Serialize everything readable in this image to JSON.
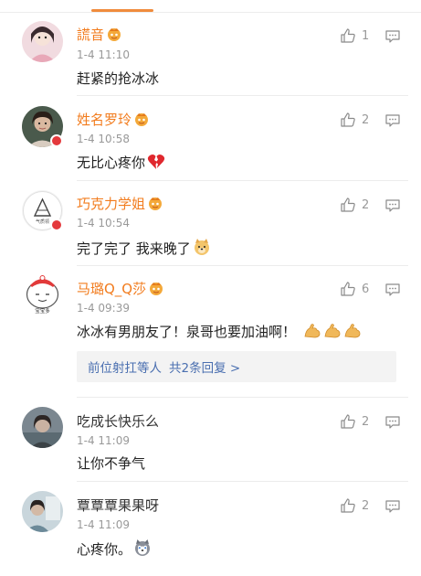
{
  "comments": [
    {
      "username": "謊音",
      "vip": true,
      "time": "1-4 11:10",
      "text": "赶紧的抢冰冰",
      "likes": "1"
    },
    {
      "username": "姓名罗玲",
      "vip": true,
      "time": "1-4 10:58",
      "text": "无比心疼你",
      "likes": "2",
      "emoji": "broken-heart-icon"
    },
    {
      "username": "巧克力学姐",
      "vip": true,
      "time": "1-4 10:54",
      "text": "完了完了 我来晚了",
      "likes": "2",
      "emoji": "doge-icon"
    },
    {
      "username": "马璐Q_Q莎",
      "vip": true,
      "time": "1-4 09:39",
      "text": "冰冰有男朋友了！泉哥也要加油啊！",
      "likes": "6",
      "emoji": "flexed-biceps-icon",
      "reply_name": "前位射扛等人",
      "reply_link": "共2条回复 >"
    },
    {
      "username": "吃成长快乐么",
      "vip": false,
      "time": "1-4 11:09",
      "text": "让你不争气",
      "likes": "2"
    },
    {
      "username": "覃覃覃果果呀",
      "vip": false,
      "time": "1-4 11:09",
      "text": "心疼你。",
      "likes": "2",
      "emoji": "husky-icon"
    }
  ],
  "colors": {
    "vip_name": "#f27c1e",
    "reply_link": "#4a6fb0",
    "tab_indicator": "#f08b3c"
  }
}
